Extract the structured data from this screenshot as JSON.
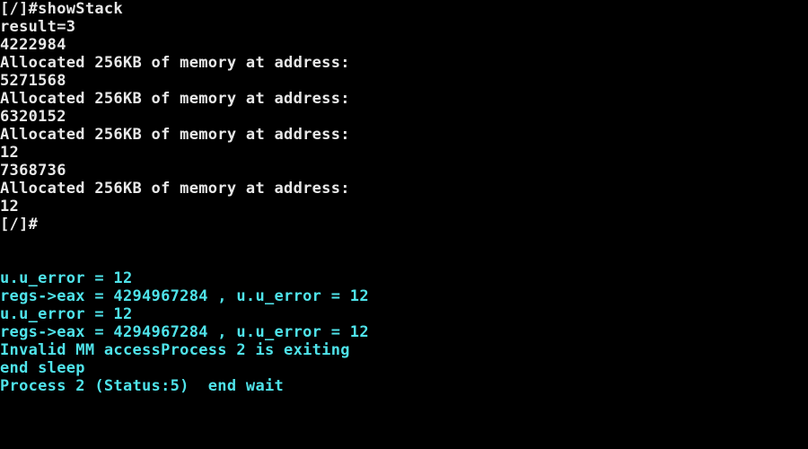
{
  "colors": {
    "background": "#000000",
    "shell_text": "#e8e8e8",
    "kernel_text": "#4fe3ea"
  },
  "terminal": {
    "shell_lines": [
      "[/]#showStack",
      "result=3",
      "4222984",
      "Allocated 256KB of memory at address:",
      "5271568",
      "Allocated 256KB of memory at address:",
      "6320152",
      "Allocated 256KB of memory at address:",
      "12",
      "7368736",
      "Allocated 256KB of memory at address:",
      "12",
      "[/]#"
    ],
    "kernel_lines": [
      "u.u_error = 12",
      "regs->eax = 4294967284 , u.u_error = 12",
      "u.u_error = 12",
      "regs->eax = 4294967284 , u.u_error = 12",
      "Invalid MM accessProcess 2 is exiting",
      "end sleep",
      "Process 2 (Status:5)  end wait"
    ]
  }
}
